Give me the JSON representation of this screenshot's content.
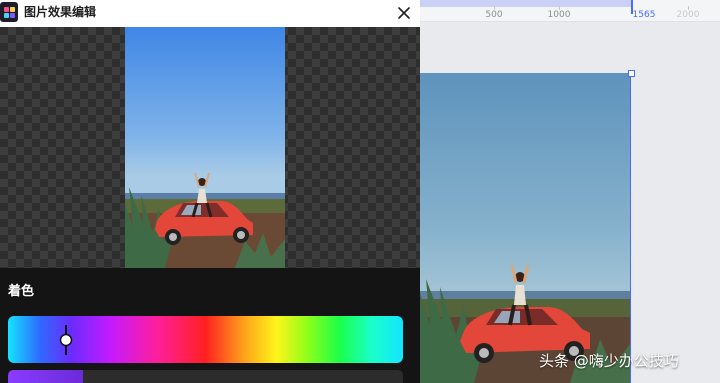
{
  "dialog": {
    "title": "图片效果编辑",
    "section_title": "着色",
    "hue_position": 0.148,
    "saturation_level": 0.19
  },
  "ruler": {
    "ticks": [
      {
        "label": "500",
        "state": "normal"
      },
      {
        "label": "1000",
        "state": "normal"
      },
      {
        "label": "1565",
        "state": "active"
      },
      {
        "label": "2000",
        "state": "faint"
      }
    ]
  },
  "watermark": {
    "text": "头条 @嗨少办公技巧"
  },
  "colors": {
    "accent": "#4a6cf7",
    "dialog_bg": "#141414",
    "saturation_fill": "#8a3cff"
  }
}
